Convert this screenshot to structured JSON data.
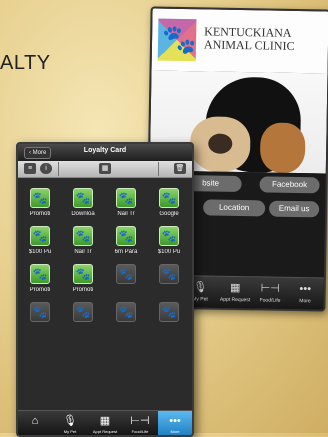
{
  "heading": "ALTY",
  "back_phone": {
    "clinic_name": "KENTUCKIANA ANIMAL CLINIC",
    "pills": [
      "bsite",
      "Facebook",
      "Location",
      "Email us"
    ],
    "tabs": [
      {
        "icon": "mic-icon",
        "label": "My Pet"
      },
      {
        "icon": "calendar-icon",
        "label": "Appt Request"
      },
      {
        "icon": "bone-icon",
        "label": "Food/Life"
      },
      {
        "icon": "more-icon",
        "label": "More"
      }
    ]
  },
  "front_phone": {
    "back_label": "More",
    "title": "Loyalty Card",
    "cells": [
      {
        "label": "Promoti",
        "state": "active"
      },
      {
        "label": "Downloa",
        "state": "active"
      },
      {
        "label": "Nail Tr",
        "state": "active"
      },
      {
        "label": "Google",
        "state": "active"
      },
      {
        "label": "$100 Pu",
        "state": "active"
      },
      {
        "label": "Nail Tr",
        "state": "active"
      },
      {
        "label": "6m Para",
        "state": "active"
      },
      {
        "label": "$100 Pu",
        "state": "active"
      },
      {
        "label": "Promoti",
        "state": "active"
      },
      {
        "label": "Promoti",
        "state": "active"
      },
      {
        "label": "",
        "state": "empty"
      },
      {
        "label": "",
        "state": "empty"
      },
      {
        "label": "",
        "state": "empty"
      },
      {
        "label": "",
        "state": "empty"
      },
      {
        "label": "",
        "state": "empty"
      },
      {
        "label": "",
        "state": "empty"
      }
    ],
    "tabs": [
      {
        "icon": "home-icon",
        "label": "",
        "active": false
      },
      {
        "icon": "mic-icon",
        "label": "My Pet",
        "active": false
      },
      {
        "icon": "calendar-icon",
        "label": "Appt Request",
        "active": false
      },
      {
        "icon": "bone-icon",
        "label": "Food/Life",
        "active": false
      },
      {
        "icon": "more-icon",
        "label": "More",
        "active": true
      }
    ]
  },
  "colors": {
    "tile_green": "#5bb33f",
    "active_tab_blue": "#3a9ee0",
    "background_tan": "#e7cf8e"
  }
}
